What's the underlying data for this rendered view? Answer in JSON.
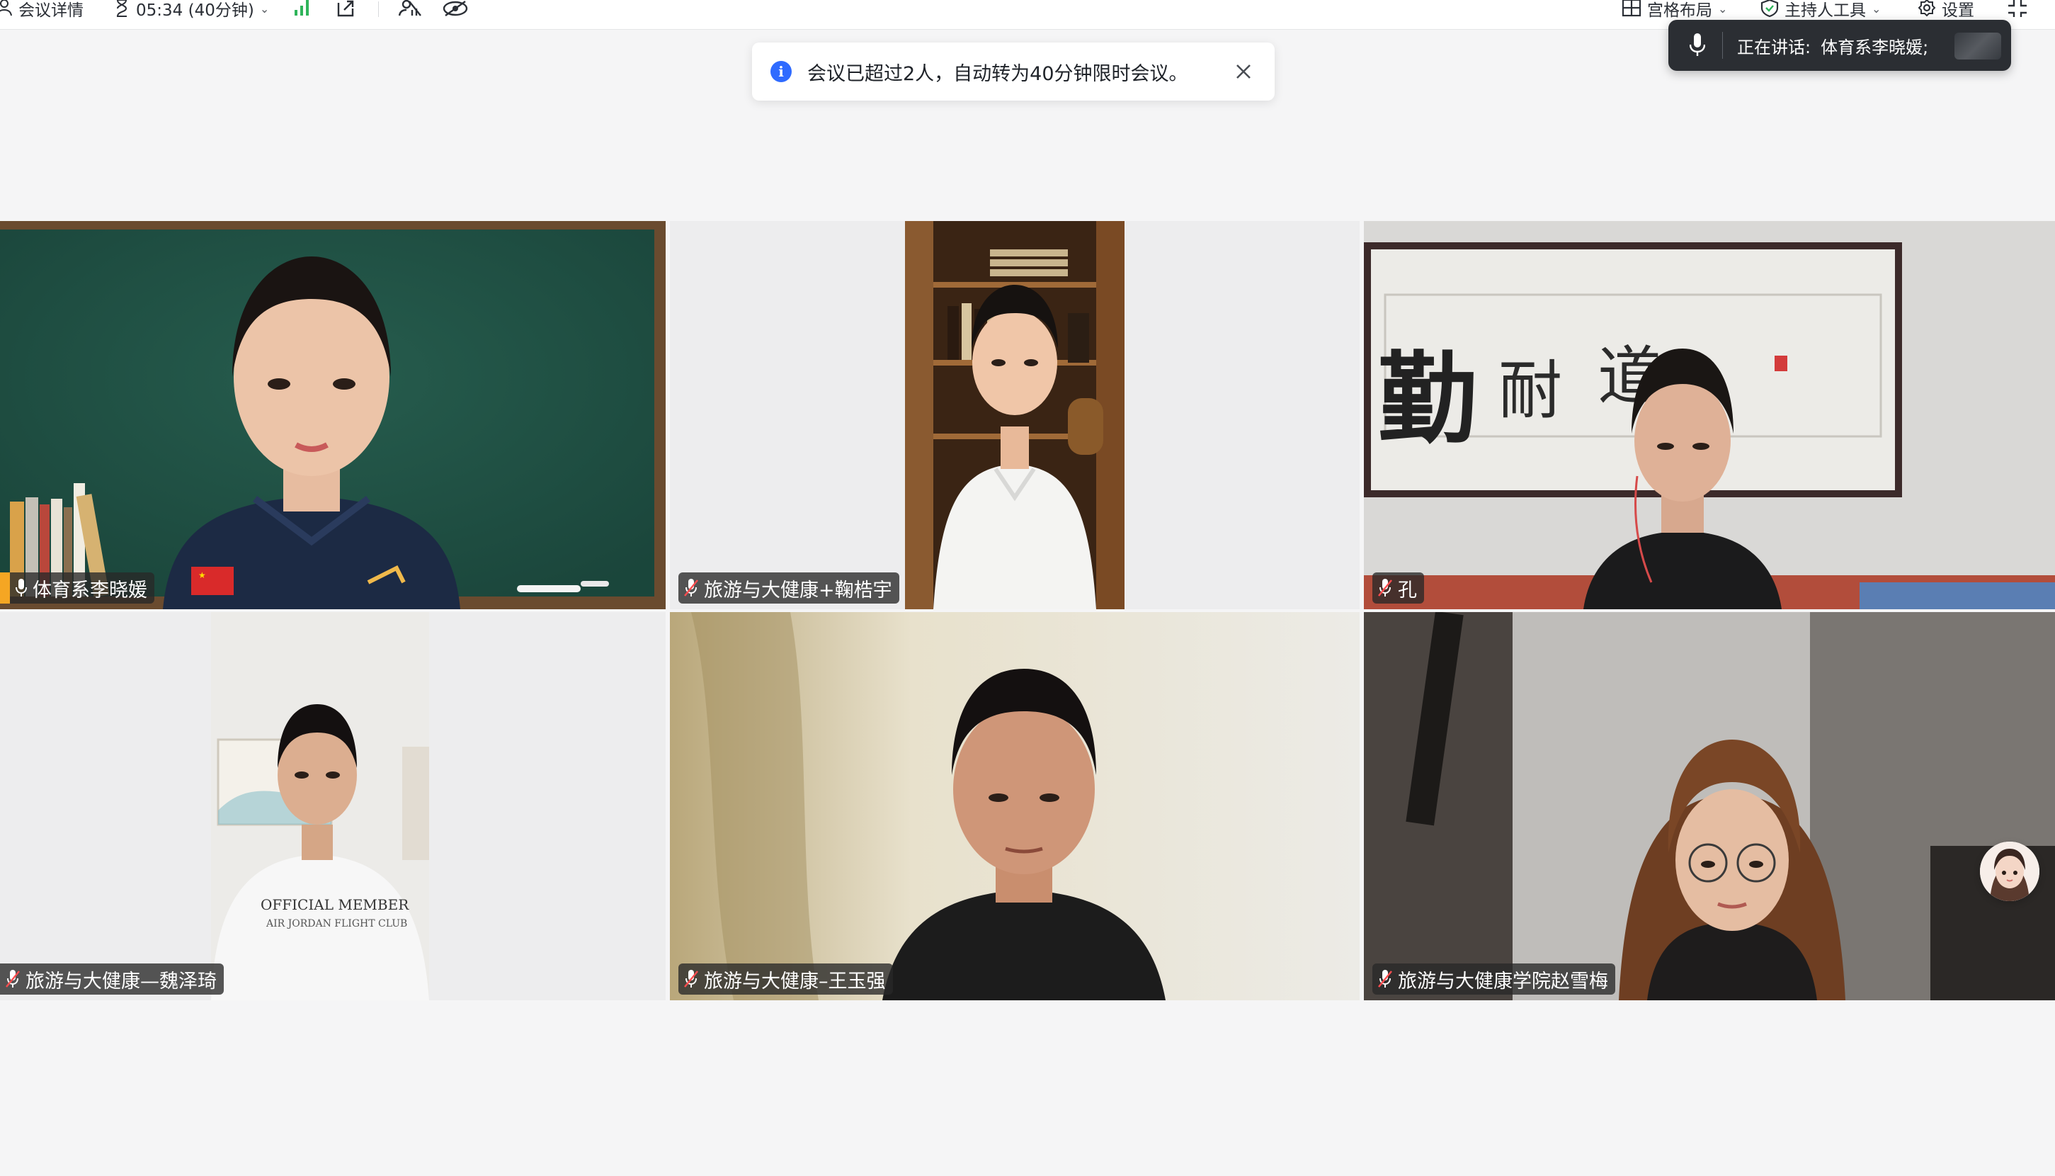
{
  "toolbar": {
    "meeting_details": "会议详情",
    "timer": "05:34 (40分钟)",
    "layout": "宫格布局",
    "host_tools": "主持人工具",
    "settings": "设置"
  },
  "notice": {
    "text": "会议已超过2人，自动转为40分钟限时会议。"
  },
  "speaking": {
    "label": "正在讲话:",
    "name": "体育系李晓媛;"
  },
  "participants": [
    {
      "name": "体育系李晓媛"
    },
    {
      "name": "旅游与大健康+鞠梏宇"
    },
    {
      "name": "孔"
    },
    {
      "name": "旅游与大健康—魏泽琦"
    },
    {
      "name": "旅游与大健康–王玉强"
    },
    {
      "name": "旅游与大健康学院赵雪梅"
    }
  ],
  "colors": {
    "active_border": "#4fc87a",
    "accent_blue": "#2f6bff",
    "tooltip_bg": "#2b2e33"
  },
  "icons": [
    "user-icon",
    "hourglass-icon",
    "signal-icon",
    "share-icon",
    "mute-all-icon",
    "hide-video-icon",
    "grid-layout-icon",
    "shield-icon",
    "gear-icon",
    "collapse-icon",
    "info-icon",
    "close-icon",
    "microphone-icon",
    "mic-off-icon"
  ]
}
